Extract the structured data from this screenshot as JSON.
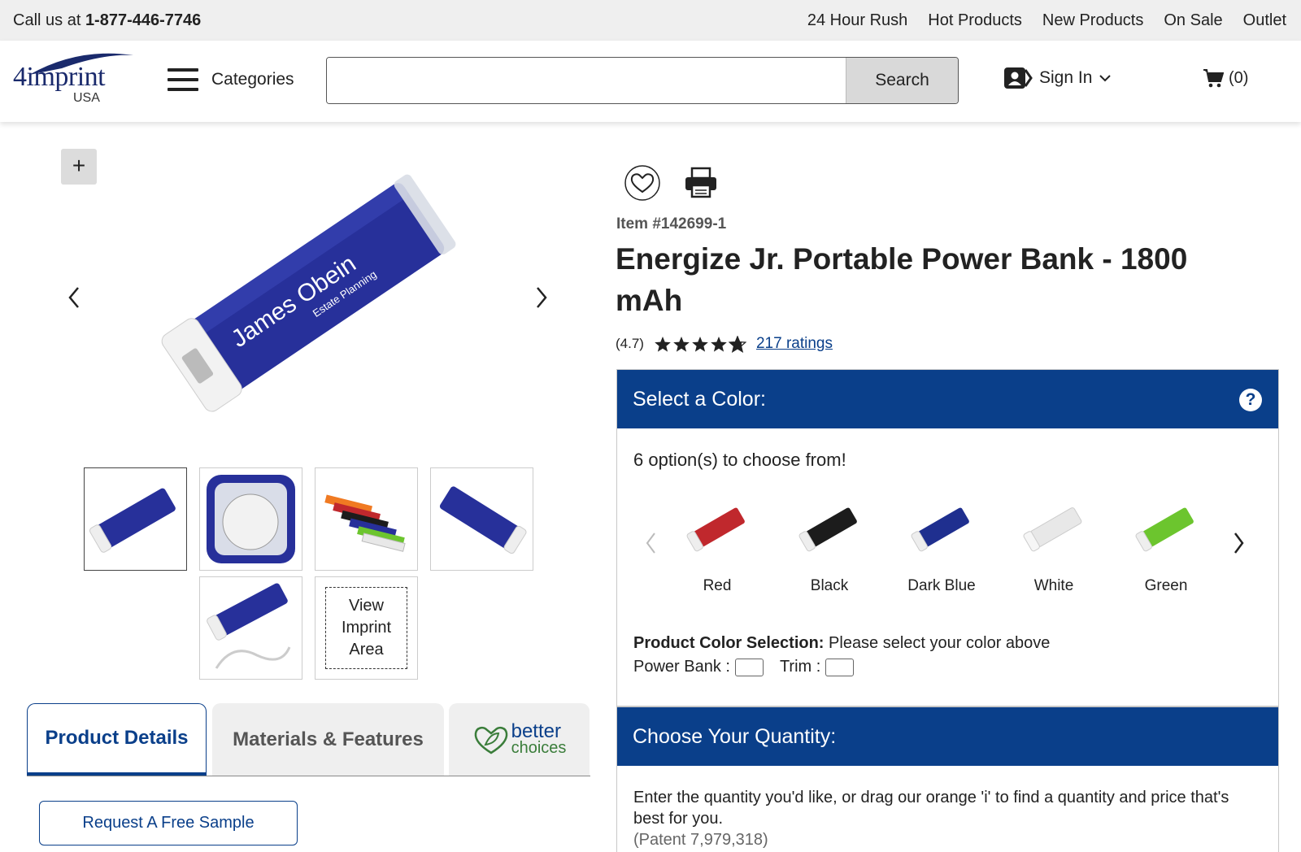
{
  "utility_bar": {
    "call_prefix": "Call us at",
    "phone": "1-877-446-7746",
    "links": [
      "24 Hour Rush",
      "Hot Products",
      "New Products",
      "On Sale",
      "Outlet"
    ]
  },
  "header": {
    "logo_text": "4imprint",
    "logo_region": "USA",
    "categories_label": "Categories",
    "search": {
      "value": "",
      "placeholder": "",
      "button_label": "Search"
    },
    "sign_in_label": "Sign In",
    "cart_count": "(0)"
  },
  "gallery": {
    "zoom_label": "+",
    "main_image_imprint": "James Obein",
    "main_image_imprint_sub": "Estate Planning",
    "thumbnail_count": 5,
    "view_imprint_label": "View Imprint Area"
  },
  "tabs": {
    "product_details": "Product Details",
    "materials_features": "Materials & Features",
    "better_choices_line1": "better",
    "better_choices_line2": "choices"
  },
  "request_sample_label": "Request A Free Sample",
  "product": {
    "item_number": "Item #142699-1",
    "title": "Energize Jr. Portable Power Bank - 1800 mAh",
    "rating_value": "(4.7)",
    "rating_stars": 4.7,
    "ratings_link": "217 ratings"
  },
  "color_panel": {
    "heading": "Select a Color:",
    "help_icon": "?",
    "options_text": "6 option(s) to choose from!",
    "swatches": [
      {
        "label": "Red",
        "color": "#c0282d"
      },
      {
        "label": "Black",
        "color": "#1c1c1c"
      },
      {
        "label": "Dark Blue",
        "color": "#1f2f8f"
      },
      {
        "label": "White",
        "color": "#e8e8e8"
      },
      {
        "label": "Green",
        "color": "#6cc52e"
      }
    ],
    "selection_label": "Product Color Selection:",
    "selection_value": "Please select your color above",
    "power_bank_label": "Power Bank :",
    "trim_label": "Trim :"
  },
  "quantity_panel": {
    "heading": "Choose Your Quantity:",
    "text": "Enter the quantity you'd like, or drag our orange 'i' to find a quantity and price that's best for you.",
    "patent": "(Patent 7,979,318)"
  },
  "colors": {
    "brand_blue": "#0a3f8a",
    "main_product": "#1f2f8f"
  }
}
